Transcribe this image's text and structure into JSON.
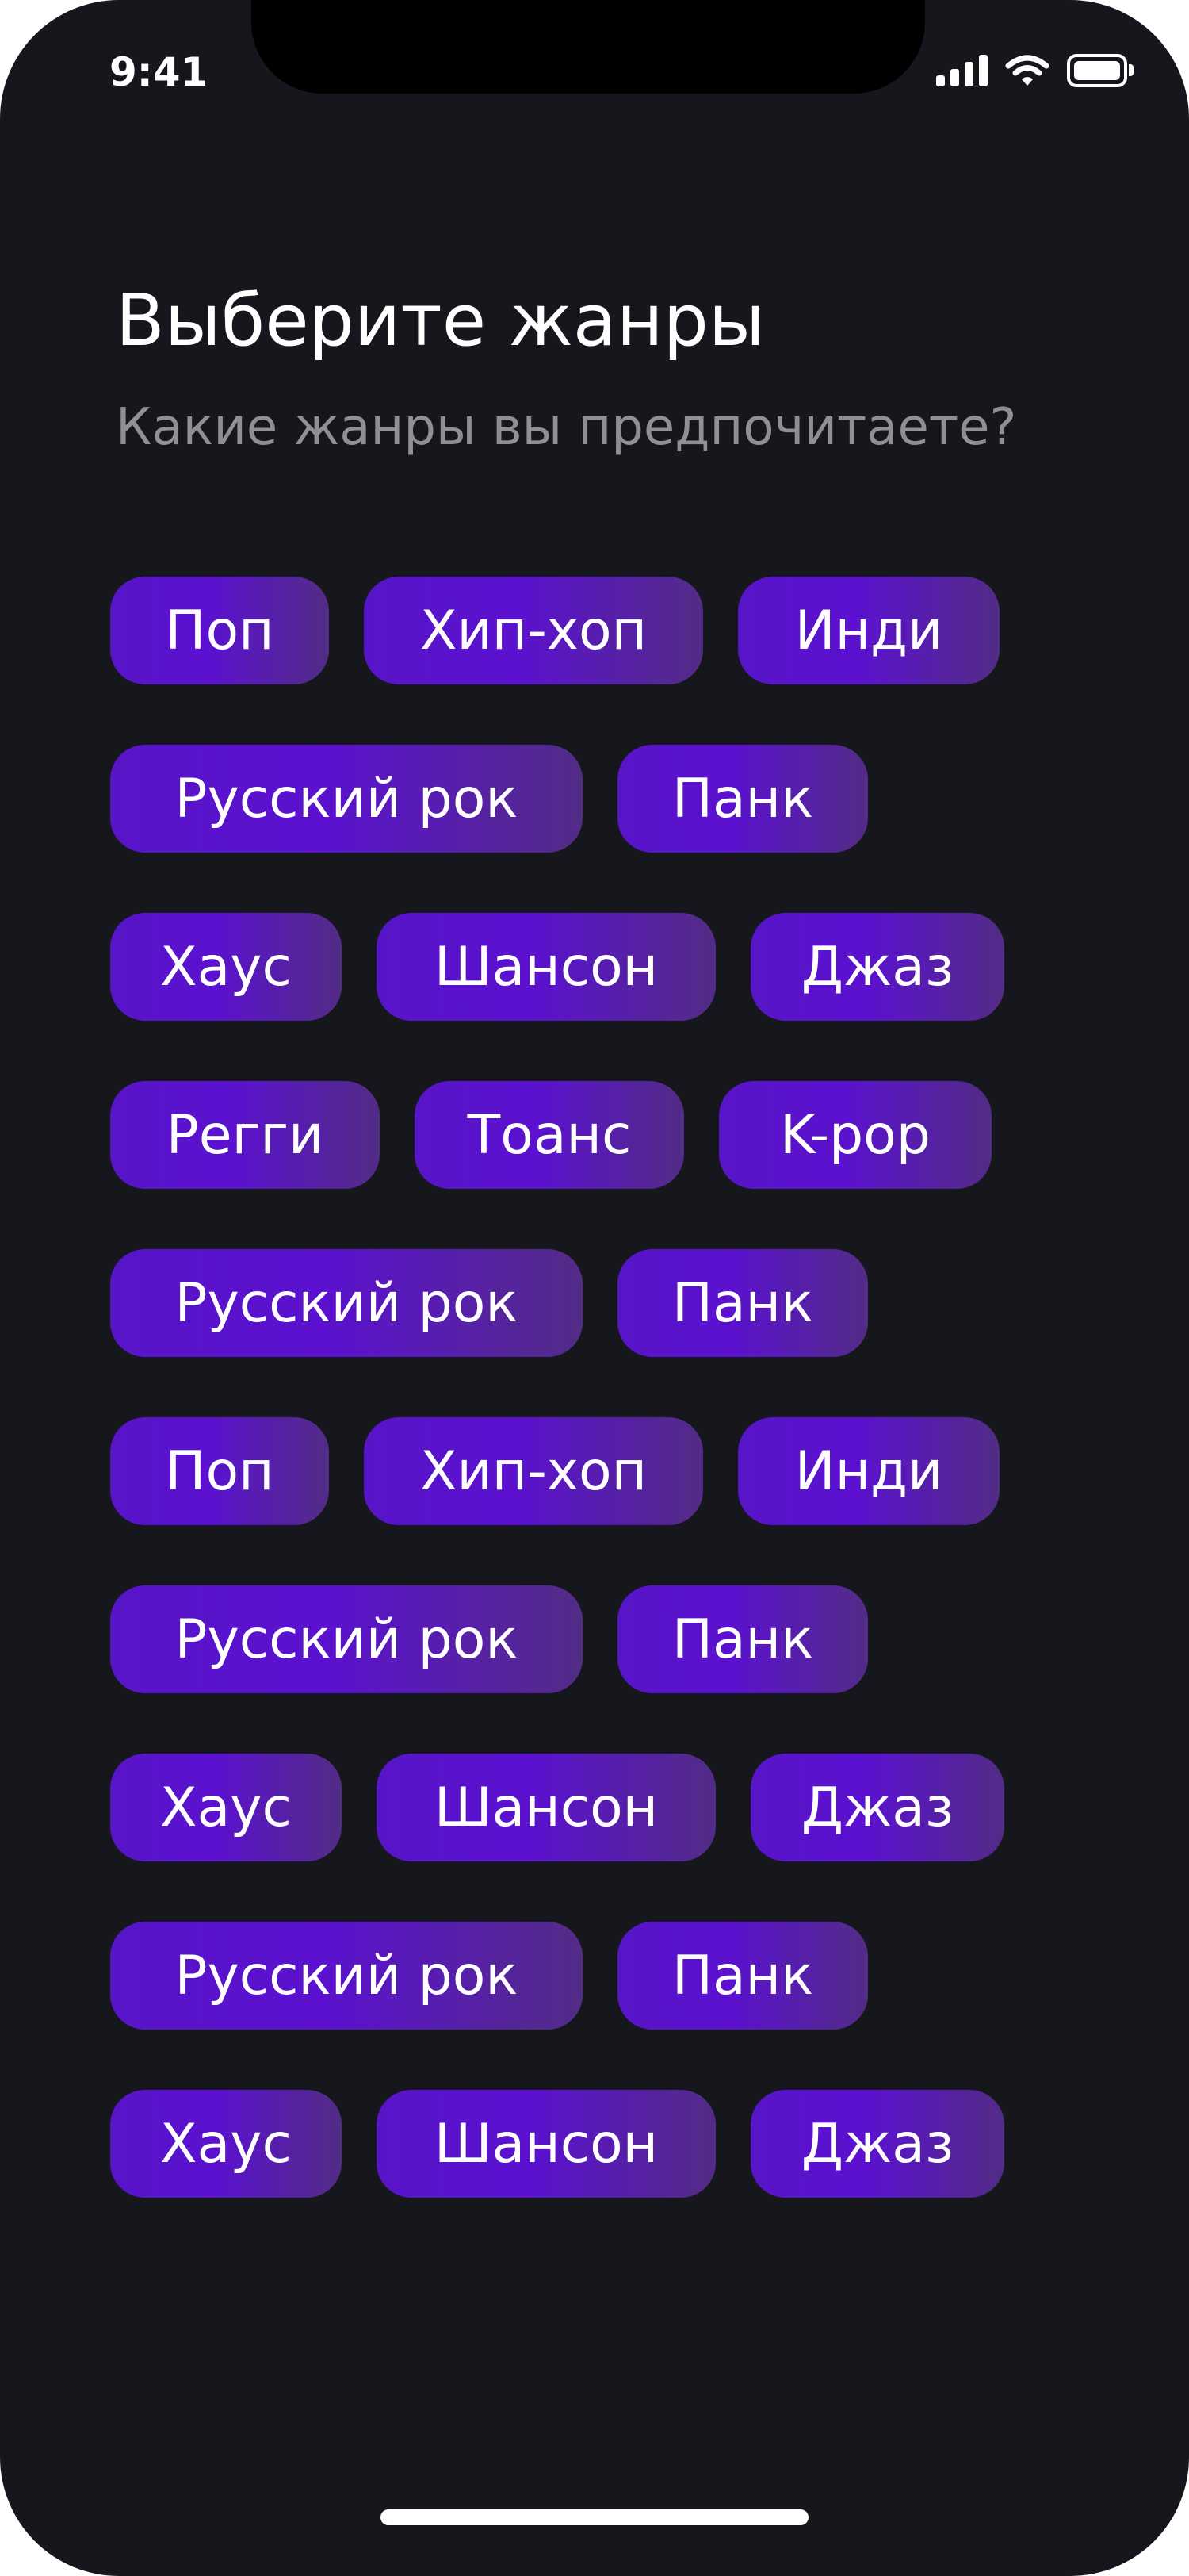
{
  "status_bar": {
    "time": "9:41",
    "icons": [
      "signal-icon",
      "wifi-icon",
      "battery-icon"
    ]
  },
  "header": {
    "title": "Выберите жанры",
    "subtitle": "Какие жанры вы предпочитаете?"
  },
  "genre_rows": [
    [
      "Поп",
      "Хип-хоп",
      "Инди"
    ],
    [
      "Русский рок",
      "Панк"
    ],
    [
      "Хаус",
      "Шансон",
      "Джаз"
    ],
    [
      "Регги",
      "Тоанс",
      "K-pop"
    ],
    [
      "Русский рок",
      "Панк"
    ],
    [
      "Поп",
      "Хип-хоп",
      "Инди"
    ],
    [
      "Русский рок",
      "Панк"
    ],
    [
      "Хаус",
      "Шансон",
      "Джаз"
    ],
    [
      "Русский рок",
      "Панк"
    ],
    [
      "Хаус",
      "Шансон",
      "Джаз"
    ]
  ],
  "colors": {
    "background": "#16171c",
    "chip_gradient_start": "#5815c8",
    "chip_gradient_end": "#522c86",
    "subtitle": "#8f8f96"
  }
}
